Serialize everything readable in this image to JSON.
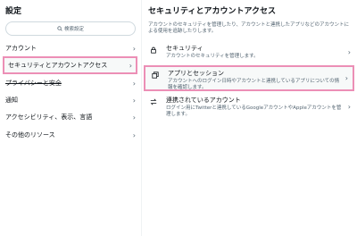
{
  "left": {
    "title": "設定",
    "search_placeholder": "検索設定",
    "items": [
      {
        "label": "アカウント"
      },
      {
        "label": "セキュリティとアカウントアクセス"
      },
      {
        "label": "プライバシーと安全"
      },
      {
        "label": "通知"
      },
      {
        "label": "アクセシビリティ、表示、言語"
      },
      {
        "label": "その他のリソース"
      }
    ]
  },
  "right": {
    "title": "セキュリティとアカウントアクセス",
    "description": "アカウントのセキュリティを管理したり、アカウントと連携したアプリなどのアカウントによる使用を追跡したりします。",
    "options": [
      {
        "label": "セキュリティ",
        "sub": "アカウントのセキュリティを管理します。",
        "icon": "lock-icon"
      },
      {
        "label": "アプリとセッション",
        "sub": "アカウントへのログイン日時やアカウントと連携しているアプリについての情報を確認します。",
        "icon": "sessions-icon"
      },
      {
        "label": "連携されているアカウント",
        "sub": "ログイン用にTwitterと連携しているGoogleアカウントやAppleアカウントを管理します。",
        "icon": "swap-icon"
      }
    ]
  },
  "colors": {
    "highlight": "#ec8fb6",
    "muted": "#536471",
    "border": "#cfd9de"
  }
}
